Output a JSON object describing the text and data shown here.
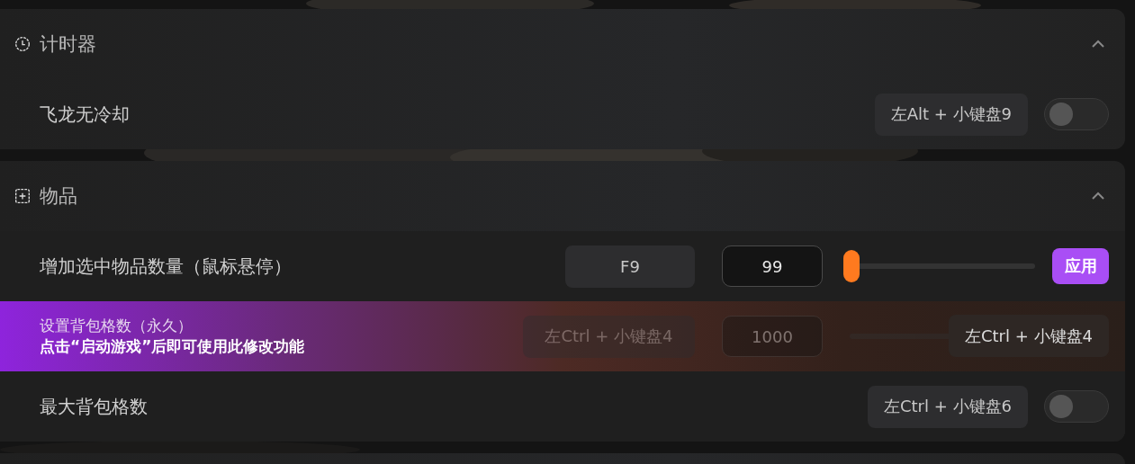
{
  "sections": [
    {
      "title": "计时器",
      "kind": "clock",
      "expanded": true,
      "rows": [
        {
          "kind": "toggle",
          "label": "飞龙无冷却",
          "hotkey": "左Alt + 小键盘9",
          "on": false
        }
      ]
    },
    {
      "title": "物品",
      "kind": "item",
      "expanded": true,
      "rows": [
        {
          "kind": "slider",
          "label": "增加选中物品数量（鼠标悬停）",
          "hotkey": "F9",
          "value": "99",
          "level": 0,
          "button": "应用"
        },
        {
          "kind": "locked",
          "label": "设置背包格数（永久）",
          "note": "点击“启动游戏”后即可使用此修改功能",
          "hotkey": "左Ctrl + 小键盘4",
          "value": "1000",
          "overlay_hotkey": "左Ctrl + 小键盘4"
        },
        {
          "kind": "toggle",
          "label": "最大背包格数",
          "hotkey": "左Ctrl + 小键盘6",
          "on": false
        }
      ]
    }
  ]
}
